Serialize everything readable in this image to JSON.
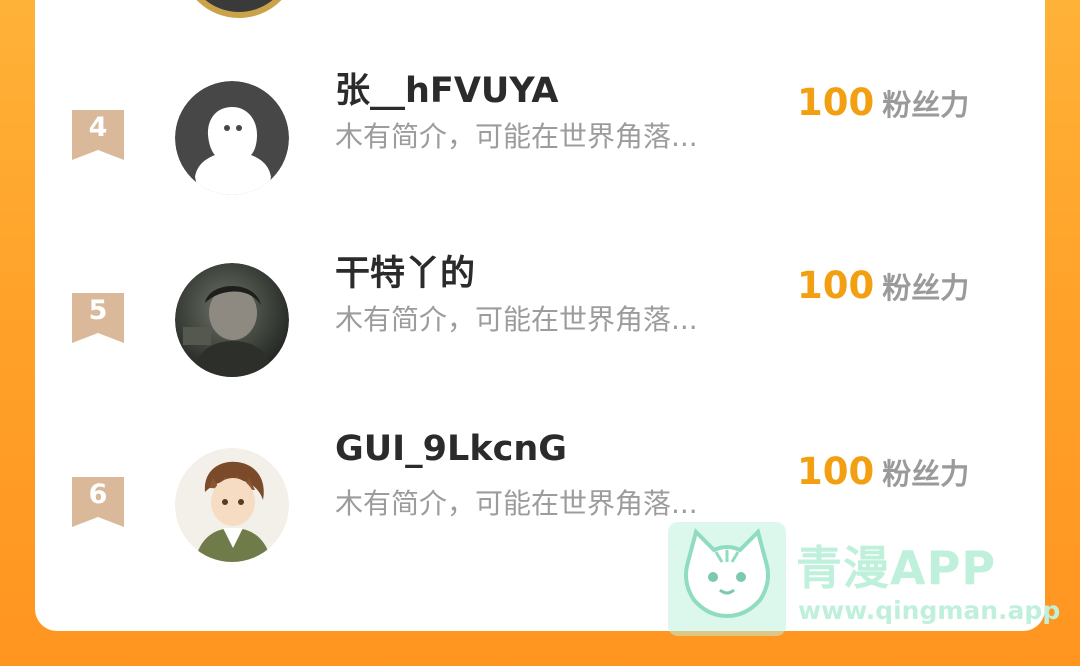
{
  "colors": {
    "background_accent": "#ffa22a",
    "fans_value": "#f2a012",
    "rank_badge": "#d9b99a",
    "watermark": "#bff0dc"
  },
  "leaderboard": {
    "items": [
      {
        "rank": "4",
        "username": "张__hFVUYA",
        "bio": "木有简介，可能在世界角落...",
        "fans_value": "100",
        "fans_label": "粉丝力",
        "avatar_icon": "default-ghost-avatar"
      },
      {
        "rank": "5",
        "username": "干特丫的",
        "bio": "木有简介，可能在世界角落...",
        "fans_value": "100",
        "fans_label": "粉丝力",
        "avatar_icon": "photo-avatar"
      },
      {
        "rank": "6",
        "username": "GUI_9LkcnG",
        "bio": "木有简介，可能在世界角落...",
        "fans_value": "100",
        "fans_label": "粉丝力",
        "avatar_icon": "anime-avatar"
      }
    ]
  },
  "watermark": {
    "title": "青漫APP",
    "url": "www.qingman.app",
    "icon": "cat-logo-icon"
  }
}
